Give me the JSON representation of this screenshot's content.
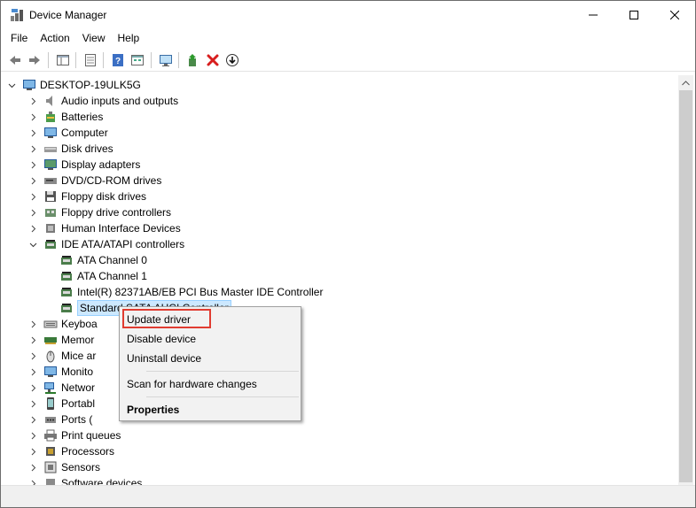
{
  "window": {
    "title": "Device Manager",
    "icon": "device-manager-icon"
  },
  "menu": [
    "File",
    "Action",
    "View",
    "Help"
  ],
  "toolbar": {
    "buttons": [
      "back-arrow-icon",
      "forward-arrow-icon",
      "show-hide-tree-icon",
      "properties-icon",
      "help-icon",
      "action-view-icon",
      "monitor-scan-icon",
      "update-driver-icon",
      "uninstall-x-icon",
      "disable-down-arrow-icon"
    ]
  },
  "tree": {
    "root": "DESKTOP-19ULK5G",
    "categories": [
      {
        "label": "Audio inputs and outputs",
        "icon": "speaker-icon",
        "expanded": false
      },
      {
        "label": "Batteries",
        "icon": "battery-icon",
        "expanded": false
      },
      {
        "label": "Computer",
        "icon": "computer-icon",
        "expanded": false
      },
      {
        "label": "Disk drives",
        "icon": "disk-drive-icon",
        "expanded": false
      },
      {
        "label": "Display adapters",
        "icon": "display-adapter-icon",
        "expanded": false
      },
      {
        "label": "DVD/CD-ROM drives",
        "icon": "dvd-drive-icon",
        "expanded": false
      },
      {
        "label": "Floppy disk drives",
        "icon": "floppy-disk-icon",
        "expanded": false
      },
      {
        "label": "Floppy drive controllers",
        "icon": "floppy-controller-icon",
        "expanded": false
      },
      {
        "label": "Human Interface Devices",
        "icon": "hid-icon",
        "expanded": false
      },
      {
        "label": "IDE ATA/ATAPI controllers",
        "icon": "ide-controller-icon",
        "expanded": true
      }
    ],
    "ide_children": [
      "ATA Channel 0",
      "ATA Channel 1",
      "Intel(R) 82371AB/EB PCI Bus Master IDE Controller",
      "Standard SATA AHCI Controller"
    ],
    "categories_after": [
      {
        "label": "Keyboards",
        "visible": "Keyboa",
        "icon": "keyboard-icon"
      },
      {
        "label": "Memory",
        "visible": "Memor",
        "icon": "memory-icon"
      },
      {
        "label": "Mice and other pointing devices",
        "visible": "Mice ar",
        "icon": "mouse-icon"
      },
      {
        "label": "Monitors",
        "visible": "Monito",
        "icon": "monitor-icon"
      },
      {
        "label": "Network adapters",
        "visible": "Networ",
        "icon": "network-icon"
      },
      {
        "label": "Portable Devices",
        "visible": "Portabl",
        "icon": "portable-device-icon"
      },
      {
        "label": "Ports (COM & LPT)",
        "visible": "Ports (",
        "icon": "port-icon"
      },
      {
        "label": "Print queues",
        "visible": "Print queues",
        "icon": "printer-icon"
      },
      {
        "label": "Processors",
        "visible": "Processors",
        "icon": "processor-icon"
      },
      {
        "label": "Sensors",
        "visible": "Sensors",
        "icon": "sensor-icon"
      },
      {
        "label": "Software devices",
        "visible": "Software devices",
        "icon": "software-device-icon"
      }
    ]
  },
  "context_menu": {
    "items": [
      "Update driver",
      "Disable device",
      "Uninstall device",
      "Scan for hardware changes",
      "Properties"
    ]
  },
  "colors": {
    "highlight": "#e03c31",
    "selection": "#cce8ff"
  }
}
